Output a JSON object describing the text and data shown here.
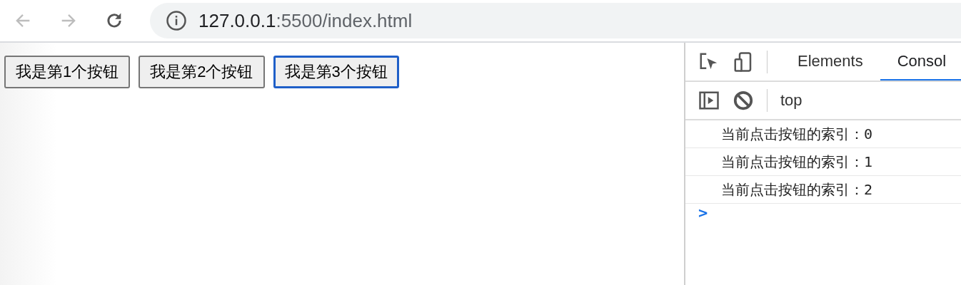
{
  "browser": {
    "url_host": "127.0.0.1",
    "url_path": ":5500/index.html"
  },
  "page": {
    "buttons": [
      {
        "label": "我是第1个按钮",
        "focused": false
      },
      {
        "label": "我是第2个按钮",
        "focused": false
      },
      {
        "label": "我是第3个按钮",
        "focused": true
      }
    ]
  },
  "devtools": {
    "tabs": [
      {
        "label": "Elements",
        "selected": false
      },
      {
        "label": "Consol",
        "selected": true
      }
    ],
    "context": "top",
    "messages": [
      "当前点击按钮的索引：0",
      "当前点击按钮的索引：1",
      "当前点击按钮的索引：2"
    ],
    "prompt": ">"
  }
}
